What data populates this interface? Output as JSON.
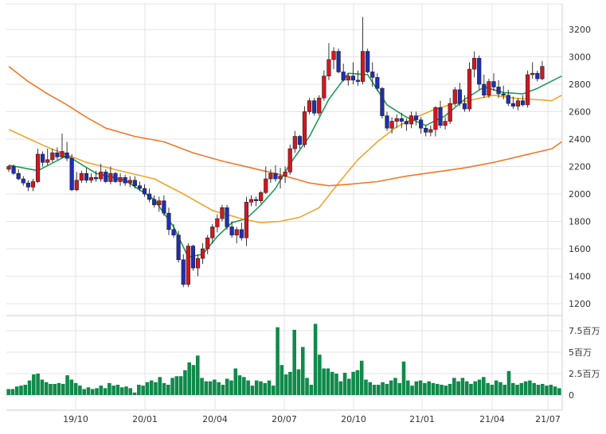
{
  "chart_data": [
    {
      "type": "candlestick",
      "title": "",
      "x_tick_labels": [
        "19/10",
        "20/01",
        "20/04",
        "20/07",
        "20/10",
        "21/01",
        "21/04",
        "21/07"
      ],
      "y_tick_labels": [
        "1200",
        "1400",
        "1600",
        "1800",
        "2000",
        "2200",
        "2400",
        "2600",
        "2800",
        "3000",
        "3200"
      ],
      "ylim": [
        1100,
        3300
      ],
      "grid": true,
      "colors": {
        "up": "#d6151f",
        "down": "#1f2db5",
        "ma_short": "#1e9a57",
        "ma_mid": "#f0a52a",
        "ma_long": "#f0782a",
        "grid": "#e3e3e3"
      },
      "ohlc": [
        [
          2180,
          2210,
          2160,
          2200
        ],
        [
          2200,
          2215,
          2140,
          2150
        ],
        [
          2150,
          2180,
          2100,
          2110
        ],
        [
          2110,
          2130,
          2060,
          2080
        ],
        [
          2080,
          2100,
          2020,
          2050
        ],
        [
          2050,
          2110,
          2020,
          2090
        ],
        [
          2090,
          2330,
          2080,
          2290
        ],
        [
          2290,
          2310,
          2200,
          2230
        ],
        [
          2230,
          2330,
          2210,
          2250
        ],
        [
          2250,
          2330,
          2230,
          2300
        ],
        [
          2300,
          2340,
          2250,
          2270
        ],
        [
          2270,
          2440,
          2260,
          2310
        ],
        [
          2300,
          2380,
          2240,
          2260
        ],
        [
          2260,
          2290,
          2020,
          2030
        ],
        [
          2030,
          2160,
          2020,
          2100
        ],
        [
          2100,
          2170,
          2080,
          2150
        ],
        [
          2150,
          2190,
          2080,
          2100
        ],
        [
          2100,
          2150,
          2080,
          2120
        ],
        [
          2120,
          2170,
          2090,
          2110
        ],
        [
          2110,
          2220,
          2090,
          2160
        ],
        [
          2160,
          2180,
          2080,
          2090
        ],
        [
          2090,
          2200,
          2070,
          2150
        ],
        [
          2150,
          2160,
          2080,
          2090
        ],
        [
          2090,
          2150,
          2060,
          2120
        ],
        [
          2120,
          2140,
          2060,
          2080
        ],
        [
          2080,
          2130,
          2050,
          2100
        ],
        [
          2100,
          2130,
          2040,
          2060
        ],
        [
          2060,
          2090,
          2020,
          2040
        ],
        [
          2040,
          2070,
          1980,
          2000
        ],
        [
          2000,
          2040,
          1940,
          1960
        ],
        [
          1960,
          1990,
          1900,
          1920
        ],
        [
          1920,
          1980,
          1870,
          1950
        ],
        [
          1950,
          1990,
          1840,
          1860
        ],
        [
          1860,
          1900,
          1700,
          1740
        ],
        [
          1740,
          1780,
          1680,
          1700
        ],
        [
          1700,
          1730,
          1500,
          1520
        ],
        [
          1520,
          1560,
          1320,
          1340
        ],
        [
          1340,
          1640,
          1320,
          1620
        ],
        [
          1620,
          1630,
          1440,
          1460
        ],
        [
          1460,
          1560,
          1400,
          1530
        ],
        [
          1530,
          1640,
          1490,
          1600
        ],
        [
          1600,
          1700,
          1560,
          1680
        ],
        [
          1680,
          1780,
          1640,
          1760
        ],
        [
          1760,
          1850,
          1720,
          1820
        ],
        [
          1820,
          1920,
          1800,
          1900
        ],
        [
          1900,
          1920,
          1740,
          1760
        ],
        [
          1760,
          1800,
          1680,
          1700
        ],
        [
          1700,
          1760,
          1640,
          1740
        ],
        [
          1740,
          1790,
          1660,
          1680
        ],
        [
          1680,
          1980,
          1620,
          1940
        ],
        [
          1940,
          1990,
          1910,
          1960
        ],
        [
          1960,
          1980,
          1910,
          1950
        ],
        [
          1950,
          2020,
          1930,
          2010
        ],
        [
          2010,
          2200,
          2000,
          2110
        ],
        [
          2110,
          2180,
          2080,
          2150
        ],
        [
          2150,
          2210,
          2090,
          2110
        ],
        [
          2110,
          2190,
          2040,
          2130
        ],
        [
          2130,
          2200,
          2080,
          2160
        ],
        [
          2160,
          2360,
          2140,
          2330
        ],
        [
          2330,
          2460,
          2300,
          2420
        ],
        [
          2420,
          2430,
          2330,
          2360
        ],
        [
          2360,
          2640,
          2340,
          2600
        ],
        [
          2600,
          2700,
          2580,
          2680
        ],
        [
          2680,
          2700,
          2570,
          2590
        ],
        [
          2590,
          2720,
          2570,
          2700
        ],
        [
          2700,
          2900,
          2680,
          2860
        ],
        [
          2860,
          3100,
          2830,
          2980
        ],
        [
          2980,
          3070,
          2910,
          3040
        ],
        [
          3040,
          3060,
          2880,
          2890
        ],
        [
          2890,
          2950,
          2820,
          2830
        ],
        [
          2830,
          2880,
          2790,
          2860
        ],
        [
          2860,
          2960,
          2800,
          2830
        ],
        [
          2830,
          2900,
          2790,
          2820
        ],
        [
          2820,
          3290,
          2800,
          3040
        ],
        [
          3040,
          3060,
          2880,
          2890
        ],
        [
          2890,
          2960,
          2780,
          2850
        ],
        [
          2850,
          2880,
          2750,
          2770
        ],
        [
          2770,
          2780,
          2550,
          2570
        ],
        [
          2570,
          2600,
          2460,
          2480
        ],
        [
          2480,
          2560,
          2440,
          2530
        ],
        [
          2530,
          2580,
          2480,
          2550
        ],
        [
          2550,
          2590,
          2480,
          2530
        ],
        [
          2530,
          2550,
          2460,
          2510
        ],
        [
          2510,
          2600,
          2480,
          2570
        ],
        [
          2570,
          2600,
          2500,
          2540
        ],
        [
          2540,
          2560,
          2440,
          2480
        ],
        [
          2480,
          2500,
          2420,
          2450
        ],
        [
          2450,
          2500,
          2420,
          2470
        ],
        [
          2470,
          2640,
          2420,
          2630
        ],
        [
          2630,
          2680,
          2480,
          2500
        ],
        [
          2500,
          2560,
          2470,
          2530
        ],
        [
          2530,
          2700,
          2510,
          2660
        ],
        [
          2660,
          2780,
          2640,
          2760
        ],
        [
          2760,
          2810,
          2640,
          2660
        ],
        [
          2660,
          2720,
          2600,
          2620
        ],
        [
          2620,
          2960,
          2600,
          2910
        ],
        [
          2910,
          3040,
          2850,
          2990
        ],
        [
          2990,
          3010,
          2760,
          2800
        ],
        [
          2800,
          2870,
          2700,
          2720
        ],
        [
          2720,
          2840,
          2700,
          2820
        ],
        [
          2820,
          2880,
          2750,
          2780
        ],
        [
          2780,
          2830,
          2700,
          2730
        ],
        [
          2730,
          2790,
          2690,
          2720
        ],
        [
          2720,
          2760,
          2640,
          2660
        ],
        [
          2660,
          2710,
          2620,
          2640
        ],
        [
          2640,
          2700,
          2610,
          2680
        ],
        [
          2680,
          2720,
          2640,
          2650
        ],
        [
          2650,
          2900,
          2630,
          2870
        ],
        [
          2870,
          2960,
          2840,
          2880
        ],
        [
          2880,
          2900,
          2820,
          2840
        ],
        [
          2840,
          2970,
          2830,
          2930
        ]
      ],
      "moving_averages": [
        {
          "points": [
            [
              0,
              2210
            ],
            [
              6,
              2170
            ],
            [
              12,
              2280
            ],
            [
              18,
              2150
            ],
            [
              24,
              2100
            ],
            [
              30,
              1960
            ],
            [
              34,
              1760
            ],
            [
              37,
              1540
            ],
            [
              40,
              1560
            ],
            [
              43,
              1690
            ],
            [
              46,
              1790
            ],
            [
              49,
              1820
            ],
            [
              52,
              1920
            ],
            [
              55,
              2040
            ],
            [
              58,
              2220
            ],
            [
              62,
              2420
            ],
            [
              66,
              2690
            ],
            [
              70,
              2880
            ],
            [
              74,
              2870
            ],
            [
              78,
              2650
            ],
            [
              82,
              2560
            ],
            [
              86,
              2500
            ],
            [
              90,
              2570
            ],
            [
              94,
              2690
            ],
            [
              98,
              2780
            ],
            [
              102,
              2740
            ],
            [
              106,
              2730
            ],
            [
              109,
              2770
            ],
            [
              114,
              2860
            ]
          ]
        },
        {
          "points": [
            [
              0,
              2470
            ],
            [
              8,
              2340
            ],
            [
              16,
              2230
            ],
            [
              24,
              2160
            ],
            [
              30,
              2110
            ],
            [
              36,
              2000
            ],
            [
              42,
              1880
            ],
            [
              48,
              1820
            ],
            [
              52,
              1790
            ],
            [
              56,
              1800
            ],
            [
              60,
              1830
            ],
            [
              64,
              1900
            ],
            [
              68,
              2080
            ],
            [
              72,
              2250
            ],
            [
              76,
              2380
            ],
            [
              80,
              2490
            ],
            [
              84,
              2560
            ],
            [
              88,
              2620
            ],
            [
              92,
              2660
            ],
            [
              96,
              2690
            ],
            [
              100,
              2720
            ],
            [
              104,
              2700
            ],
            [
              108,
              2690
            ],
            [
              112,
              2680
            ],
            [
              114,
              2720
            ]
          ]
        },
        {
          "points": [
            [
              0,
              2930
            ],
            [
              4,
              2820
            ],
            [
              8,
              2730
            ],
            [
              12,
              2650
            ],
            [
              16,
              2560
            ],
            [
              20,
              2480
            ],
            [
              26,
              2420
            ],
            [
              32,
              2380
            ],
            [
              38,
              2300
            ],
            [
              44,
              2240
            ],
            [
              50,
              2190
            ],
            [
              56,
              2140
            ],
            [
              62,
              2080
            ],
            [
              66,
              2060
            ],
            [
              70,
              2070
            ],
            [
              76,
              2090
            ],
            [
              82,
              2130
            ],
            [
              88,
              2160
            ],
            [
              94,
              2190
            ],
            [
              100,
              2230
            ],
            [
              106,
              2280
            ],
            [
              112,
              2330
            ],
            [
              114,
              2380
            ]
          ]
        }
      ]
    },
    {
      "type": "bar",
      "title": "",
      "y_tick_labels": [
        "0",
        "2.5百万",
        "5百万",
        "7.5百万"
      ],
      "ylim": [
        0,
        9500000
      ],
      "values": [
        700000,
        700000,
        1000000,
        1100000,
        1200000,
        1700000,
        2400000,
        2500000,
        1800000,
        1500000,
        1300000,
        1300000,
        1400000,
        1300000,
        2300000,
        1800000,
        1400000,
        1100000,
        700000,
        900000,
        700000,
        800000,
        1100000,
        800000,
        1400000,
        1100000,
        1200000,
        900000,
        1000000,
        800000,
        300000,
        1200000,
        1100000,
        1500000,
        1700000,
        1500000,
        2100000,
        1400000,
        1200000,
        2000000,
        2200000,
        2200000,
        2900000,
        3800000,
        3500000,
        4600000,
        2000000,
        1600000,
        1600000,
        1800000,
        1500000,
        1200000,
        1900000,
        1700000,
        3100000,
        2300000,
        2100000,
        1700000,
        1100000,
        1700000,
        1600000,
        1400000,
        1700000,
        1100000,
        7900000,
        3500000,
        2400000,
        2700000,
        7600000,
        3000000,
        5600000,
        2000000,
        1200000,
        8300000,
        4700000,
        3100000,
        3100000,
        2700000,
        2500000,
        1600000,
        2600000,
        1900000,
        2700000,
        2900000,
        4000000,
        1800000,
        1500000,
        1200000,
        1200000,
        1500000,
        1300000,
        1700000,
        2000000,
        1400000,
        3900000,
        1700000,
        1100000,
        1600000,
        1700000,
        1400000,
        1600000,
        1400000,
        1300000,
        1200000,
        1100000,
        1300000,
        2000000,
        1600000,
        2000000,
        1600000,
        1300000,
        1600000,
        1800000,
        2100000,
        1400000,
        1200000,
        1700000,
        1500000,
        1200000,
        2800000,
        1400000,
        1200000,
        1400000,
        1600000,
        1700000,
        1400000,
        1200000,
        1300000,
        1100000,
        1200000,
        1000000,
        800000
      ]
    }
  ]
}
